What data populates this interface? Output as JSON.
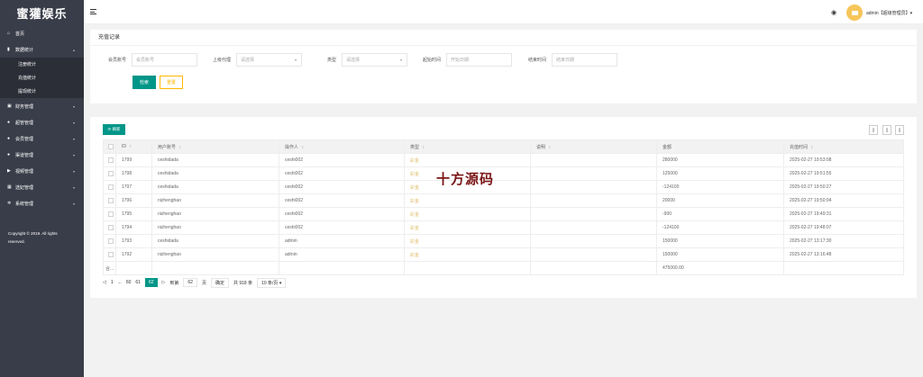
{
  "sidebar": {
    "logo": "蜜獾娱乐",
    "items": [
      {
        "label": "首页",
        "icon": "home-icon"
      },
      {
        "label": "数据统计",
        "icon": "bar-chart-icon",
        "open": true
      },
      {
        "label": "财务管理",
        "icon": "wallet-icon"
      },
      {
        "label": "超管管理",
        "icon": "user-icon"
      },
      {
        "label": "会员管理",
        "icon": "users-icon"
      },
      {
        "label": "渠道管理",
        "icon": "users-icon"
      },
      {
        "label": "视频管理",
        "icon": "video-icon"
      },
      {
        "label": "选妃管理",
        "icon": "grid-icon"
      },
      {
        "label": "系统管理",
        "icon": "gear-icon"
      }
    ],
    "sub_items": [
      "注册统计",
      "充值统计",
      "提现统计"
    ],
    "copyright_line1": "Copyright © 2019. All rights",
    "copyright_line2": "reserved."
  },
  "header": {
    "admin": "admin【超级管理员】▾"
  },
  "filter": {
    "title": "充值记录",
    "member_label": "会员账号",
    "member_placeholder": "会员账号",
    "agent_label": "上级代理",
    "agent_value": "请选择",
    "type_label": "类型",
    "type_value": "请选择",
    "start_label": "起始时间",
    "start_placeholder": "开始日期",
    "end_label": "结束时间",
    "end_placeholder": "结束日期",
    "search_btn": "检索",
    "reset_btn": "重置"
  },
  "table": {
    "refresh_btn": "刷新",
    "headers": [
      "ID",
      "用户账号",
      "操作人",
      "类型",
      "说明",
      "金额",
      "充值时间"
    ],
    "rows": [
      [
        "1799",
        "ceshidada",
        "ceshi002",
        "彩金",
        "",
        "280000",
        "2025-02-27 19:53:08"
      ],
      [
        "1798",
        "ceshidada",
        "ceshi002",
        "彩金",
        "",
        "125000",
        "2025-02-27 19:51:55"
      ],
      [
        "1797",
        "ceshidada",
        "ceshi002",
        "彩金",
        "",
        "-124100",
        "2025-02-27 19:50:27"
      ],
      [
        "1796",
        "nizhenghao",
        "ceshi002",
        "彩金",
        "",
        "20000",
        "2025-02-27 19:50:04"
      ],
      [
        "1795",
        "nizhenghao",
        "ceshi002",
        "彩金",
        "",
        "-900",
        "2025-02-27 19:49:31"
      ],
      [
        "1794",
        "nizhenghao",
        "ceshi002",
        "彩金",
        "",
        "-124100",
        "2025-02-27 19:48:07"
      ],
      [
        "1793",
        "ceshidada",
        "admin",
        "彩金",
        "",
        "150000",
        "2025-02-27 13:17:30"
      ],
      [
        "1792",
        "nizhenghao",
        "admin",
        "彩金",
        "",
        "150000",
        "2025-02-27 13:16:48"
      ]
    ],
    "total_label": "合...",
    "total_value": "475000.00"
  },
  "pager": {
    "pages": [
      "1",
      "...",
      "60",
      "61"
    ],
    "current": "62",
    "goto_label": "到第",
    "goto_value": "62",
    "page_unit": "页",
    "confirm": "确定",
    "total": "共 918 条",
    "per_page": "10 条/页"
  },
  "watermark": "十方源码"
}
